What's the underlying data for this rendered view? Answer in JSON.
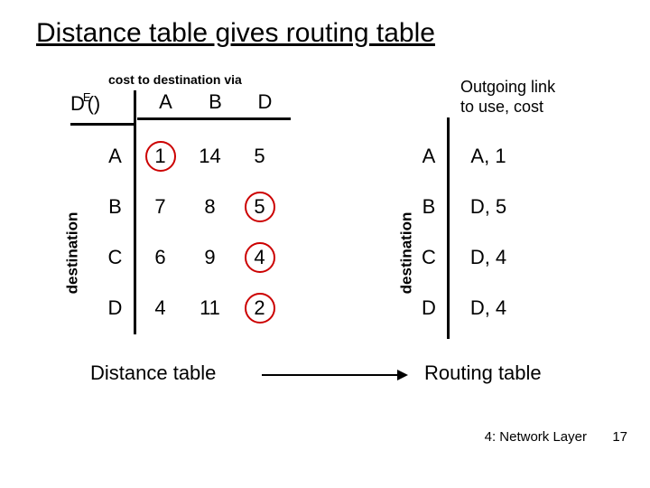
{
  "title": "Distance table gives routing table",
  "left": {
    "subtitle": "cost to destination via",
    "de_base": "D",
    "de_sup": "E",
    "de_paren": "()",
    "cols": [
      "A",
      "B",
      "D"
    ],
    "rows": [
      {
        "label": "A",
        "cells": [
          "1",
          "14",
          "5"
        ],
        "circled": 0
      },
      {
        "label": "B",
        "cells": [
          "7",
          "8",
          "5"
        ],
        "circled": 2
      },
      {
        "label": "C",
        "cells": [
          "6",
          "9",
          "4"
        ],
        "circled": 2
      },
      {
        "label": "D",
        "cells": [
          "4",
          "11",
          "2"
        ],
        "circled": 2
      }
    ],
    "axis_label": "destination"
  },
  "right": {
    "subtitle_l1": "Outgoing link",
    "subtitle_l2": "to use, cost",
    "rows": [
      {
        "label": "A",
        "value": "A, 1"
      },
      {
        "label": "B",
        "value": "D, 5"
      },
      {
        "label": "C",
        "value": "D, 4"
      },
      {
        "label": "D",
        "value": "D, 4"
      }
    ],
    "axis_label": "destination"
  },
  "bottom": {
    "left": "Distance table",
    "right": "Routing table"
  },
  "footer": {
    "section": "4: Network Layer",
    "page": "17"
  },
  "chart_data": {
    "type": "table",
    "title": "Distance table gives routing table",
    "distance_table": {
      "row_header": "destination",
      "col_header": "cost to destination via",
      "rows": [
        "A",
        "B",
        "C",
        "D"
      ],
      "cols": [
        "A",
        "B",
        "D"
      ],
      "values": [
        [
          1,
          14,
          5
        ],
        [
          7,
          8,
          5
        ],
        [
          6,
          9,
          4
        ],
        [
          4,
          11,
          2
        ]
      ],
      "min_index_per_row": [
        0,
        2,
        2,
        2
      ]
    },
    "routing_table": {
      "columns": [
        "destination",
        "Outgoing link to use, cost"
      ],
      "rows": [
        [
          "A",
          "A, 1"
        ],
        [
          "B",
          "D, 5"
        ],
        [
          "C",
          "D, 4"
        ],
        [
          "D",
          "D, 4"
        ]
      ]
    }
  }
}
